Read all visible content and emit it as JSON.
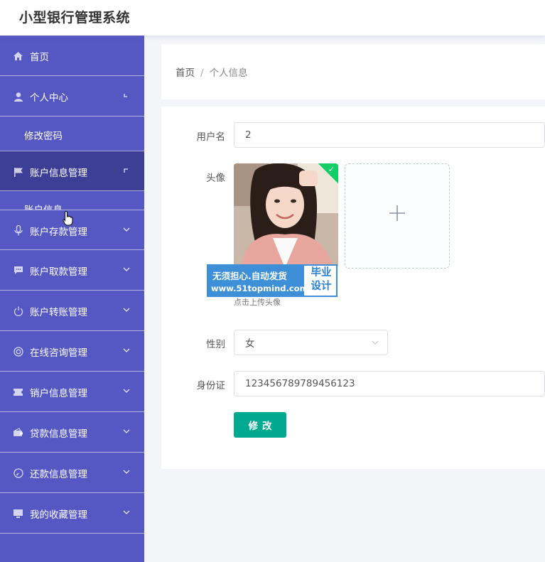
{
  "app": {
    "title": "小型银行管理系统"
  },
  "sidebar": {
    "items": [
      {
        "label": "首页",
        "icon": "home-icon"
      },
      {
        "label": "个人中心",
        "icon": "user-icon",
        "expanded": true
      },
      {
        "label": "修改密码"
      },
      {
        "label": "账户信息管理",
        "icon": "flag-icon",
        "expanded": true
      },
      {
        "label": "账户信息"
      },
      {
        "label": "账户存款管理",
        "icon": "microphone-icon"
      },
      {
        "label": "账户取款管理",
        "icon": "chat-icon"
      },
      {
        "label": "账户转账管理",
        "icon": "power-icon"
      },
      {
        "label": "在线咨询管理",
        "icon": "lifebuoy-icon"
      },
      {
        "label": "销户信息管理",
        "icon": "ticket-icon"
      },
      {
        "label": "贷款信息管理",
        "icon": "wallet-icon"
      },
      {
        "label": "还款信息管理",
        "icon": "gauge-icon"
      },
      {
        "label": "我的收藏管理",
        "icon": "monitor-icon"
      }
    ]
  },
  "breadcrumb": {
    "home": "首页",
    "separator": "/",
    "current": "个人信息"
  },
  "form": {
    "username_label": "用户名",
    "username_value": "2",
    "avatar_label": "头像",
    "avatar_hint": "点击上传头像",
    "gender_label": "性别",
    "gender_value": "女",
    "idcard_label": "身份证",
    "idcard_value": "123456789789456123",
    "submit_label": "修改"
  },
  "watermark": {
    "line1": "无须担心.自动发货",
    "line2": "www.51topmind.com",
    "right_top": "毕业",
    "right_bottom": "设计"
  },
  "colors": {
    "sidebar": "#5557c2",
    "sidebar_active": "#3d3f96",
    "button": "#00a98f",
    "upload_success": "#13ce66"
  }
}
